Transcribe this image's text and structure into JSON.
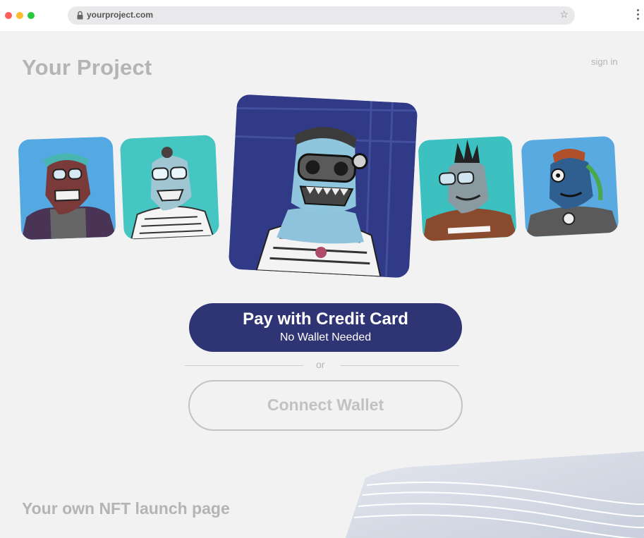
{
  "browser": {
    "url": "yourproject.com",
    "icons": {
      "lock": "lock-icon",
      "bookmark": "star-icon",
      "menu": "kebab-menu-icon"
    }
  },
  "header": {
    "title": "Your Project",
    "sign_in": "sign in"
  },
  "gallery": {
    "items": [
      {
        "name": "nft-ape-bandana-red-mask",
        "background": "#55a9e2"
      },
      {
        "name": "nft-ape-topknot-goggles",
        "background": "#46c6c3"
      },
      {
        "name": "nft-ape-featured-steampunk",
        "background": "#303a87"
      },
      {
        "name": "nft-ape-mohawk",
        "background": "#3cc0c0"
      },
      {
        "name": "nft-ape-luchador-mask",
        "background": "#5aaae2"
      }
    ]
  },
  "actions": {
    "pay_label": "Pay with Credit Card",
    "pay_sublabel": "No Wallet Needed",
    "or_text": "or",
    "connect_label": "Connect Wallet"
  },
  "footer": {
    "tagline": "Your own NFT launch page"
  },
  "colors": {
    "background": "#f2f2f3",
    "primary_button": "#2f3574",
    "muted_text": "#b4b4b6"
  }
}
